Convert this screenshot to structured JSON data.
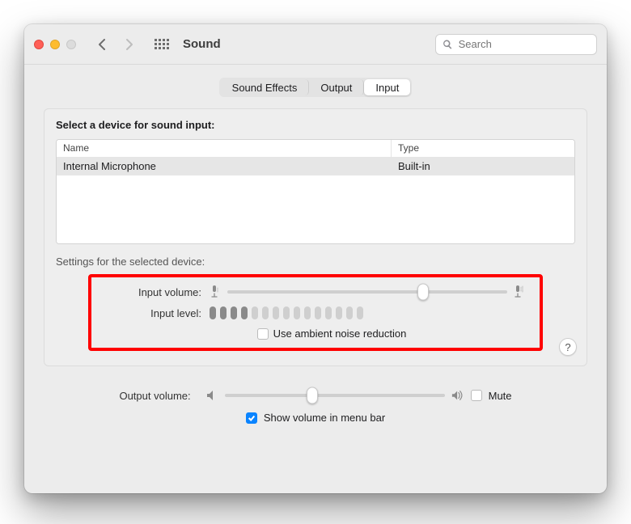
{
  "window": {
    "title": "Sound",
    "search_placeholder": "Search"
  },
  "tabs": {
    "sound_effects": "Sound Effects",
    "output": "Output",
    "input": "Input"
  },
  "panel": {
    "title": "Select a device for sound input:",
    "columns": {
      "name": "Name",
      "type": "Type"
    },
    "device": {
      "name": "Internal Microphone",
      "type": "Built-in"
    },
    "settings_title": "Settings for the selected device:"
  },
  "settings": {
    "input_volume_label": "Input volume:",
    "input_level_label": "Input level:",
    "noise_reduction_label": "Use ambient noise reduction",
    "noise_reduction_checked": false,
    "input_volume_percent": 70,
    "level_active_bars": 4,
    "level_total_bars": 15
  },
  "footer": {
    "output_volume_label": "Output volume:",
    "output_volume_percent": 40,
    "mute_label": "Mute",
    "mute_checked": false,
    "menubar_label": "Show volume in menu bar",
    "menubar_checked": true
  },
  "help_label": "?"
}
